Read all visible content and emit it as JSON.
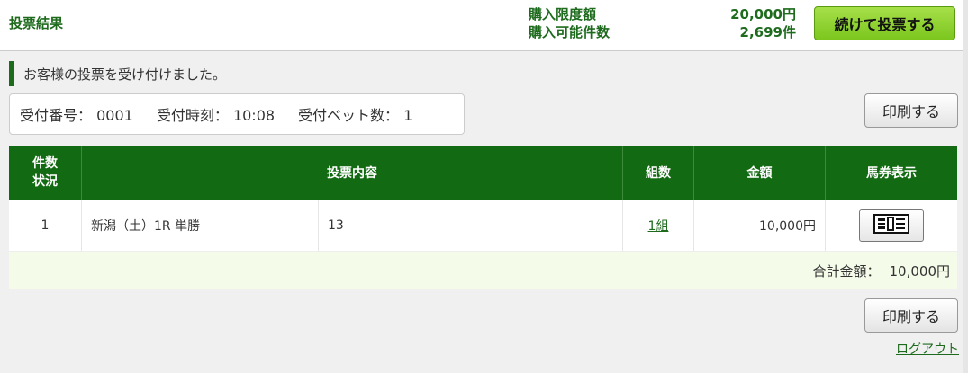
{
  "header": {
    "title": "投票結果",
    "limit_label": "購入限度額",
    "limit_value": "20,000円",
    "possible_label": "購入可能件数",
    "possible_value": "2,699件",
    "continue_button": "続けて投票する"
  },
  "message": "お客様の投票を受け付けました。",
  "receipt": {
    "number_label": "受付番号：",
    "number_value": "0001",
    "time_label": "受付時刻：",
    "time_value": "10:08",
    "bets_label": "受付ベット数：",
    "bets_value": "1"
  },
  "print_button": "印刷する",
  "table": {
    "headers": {
      "count_line1": "件数",
      "count_line2": "状況",
      "content": "投票内容",
      "combos": "組数",
      "amount": "金額",
      "ticket": "馬券表示"
    },
    "rows": [
      {
        "no": "1",
        "race": "新潟（土）1R 単勝",
        "selection": "13",
        "combos": "1組",
        "amount": "10,000円"
      }
    ],
    "total_label": "合計金額：",
    "total_value": "10,000円"
  },
  "logout": "ログアウト",
  "colors": {
    "brand_green": "#126b12",
    "accent_button": "#7cc61e",
    "total_bg": "#f5fbe9"
  },
  "icons": {
    "ticket_icon": "ticket-icon"
  }
}
